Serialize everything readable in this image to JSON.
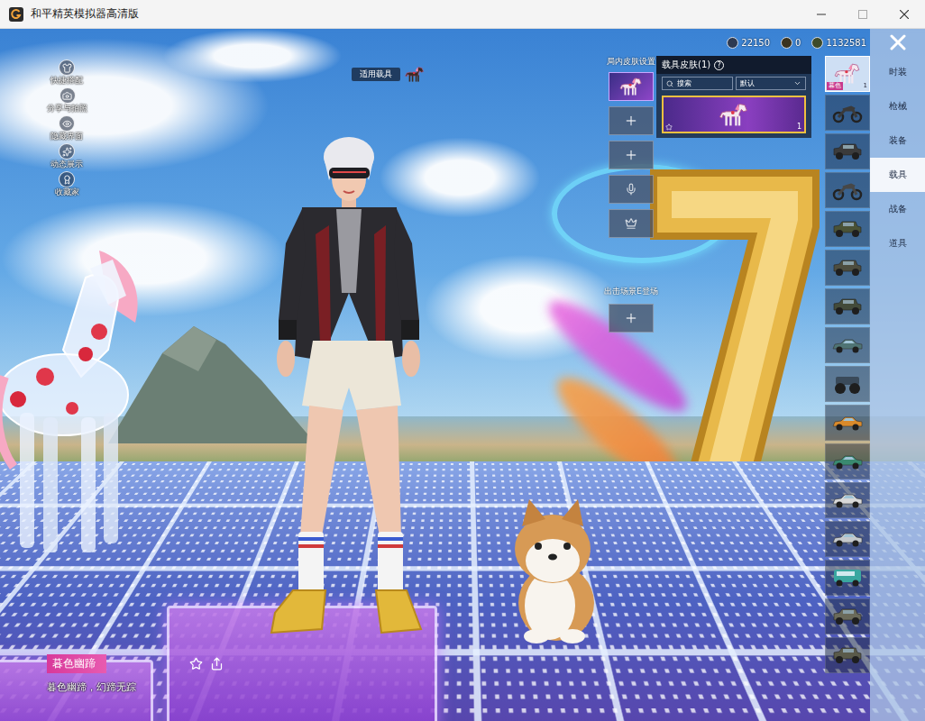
{
  "window": {
    "title": "和平精英模拟器高清版"
  },
  "side_menu": [
    {
      "label": "快捷搭配"
    },
    {
      "label": "分享与拍照"
    },
    {
      "label": "隐藏界面"
    },
    {
      "label": "动态展示"
    },
    {
      "label": "收藏家"
    }
  ],
  "vehicle_tag": {
    "label": "适用载具"
  },
  "currency": [
    {
      "amount": "22150"
    },
    {
      "amount": "0"
    },
    {
      "amount": "1132581"
    }
  ],
  "skin_slots": {
    "title": "局内皮肤设置",
    "items": [
      {
        "kind": "skin",
        "selected": true
      },
      {
        "kind": "empty",
        "selected": false
      },
      {
        "kind": "empty",
        "selected": false
      },
      {
        "kind": "voice",
        "selected": false
      },
      {
        "kind": "crown",
        "selected": false
      }
    ],
    "scene_label": "出击场景E登场",
    "scene_slot": {
      "kind": "empty",
      "selected": false
    }
  },
  "skin_panel": {
    "title": "载具皮肤(1)",
    "help": "?",
    "search": {
      "placeholder": "搜索"
    },
    "sort": {
      "value": "默认"
    },
    "cards": [
      {
        "count": "1",
        "selected": true
      }
    ]
  },
  "vehicles": [
    {
      "kind": "horse",
      "color": "#f4e8f0",
      "label": "暮色",
      "count": "1",
      "selected": true
    },
    {
      "kind": "motorcycle",
      "color": "#3a3a3a",
      "selected": false
    },
    {
      "kind": "jeep",
      "color": "#3b3b3b",
      "selected": false
    },
    {
      "kind": "motorcycle",
      "color": "#474747",
      "selected": false
    },
    {
      "kind": "jeep",
      "color": "#4a5236",
      "selected": false
    },
    {
      "kind": "jeep",
      "color": "#4d4d3f",
      "selected": false
    },
    {
      "kind": "jeep",
      "color": "#434b3a",
      "selected": false
    },
    {
      "kind": "car",
      "color": "#4f7474",
      "selected": false
    },
    {
      "kind": "truck",
      "color": "#3a4a5a",
      "selected": false
    },
    {
      "kind": "car",
      "color": "#d98a2b",
      "selected": false
    },
    {
      "kind": "car",
      "color": "#3a8a70",
      "selected": false
    },
    {
      "kind": "car",
      "color": "#d8d8d8",
      "selected": false
    },
    {
      "kind": "car",
      "color": "#c4c8cc",
      "selected": false
    },
    {
      "kind": "van",
      "color": "#3aa7a0",
      "selected": false
    },
    {
      "kind": "jeep",
      "color": "#6a6a5a",
      "selected": false
    },
    {
      "kind": "jeep",
      "color": "#5a5a4a",
      "selected": false
    }
  ],
  "categories": [
    {
      "label": "时装",
      "selected": false
    },
    {
      "label": "枪械",
      "selected": false
    },
    {
      "label": "装备",
      "selected": false
    },
    {
      "label": "载具",
      "selected": true
    },
    {
      "label": "战备",
      "selected": false
    },
    {
      "label": "道具",
      "selected": false
    }
  ],
  "item": {
    "name": "暮色幽蹄",
    "description": "暮色幽蹄，幻蹄无踪"
  }
}
